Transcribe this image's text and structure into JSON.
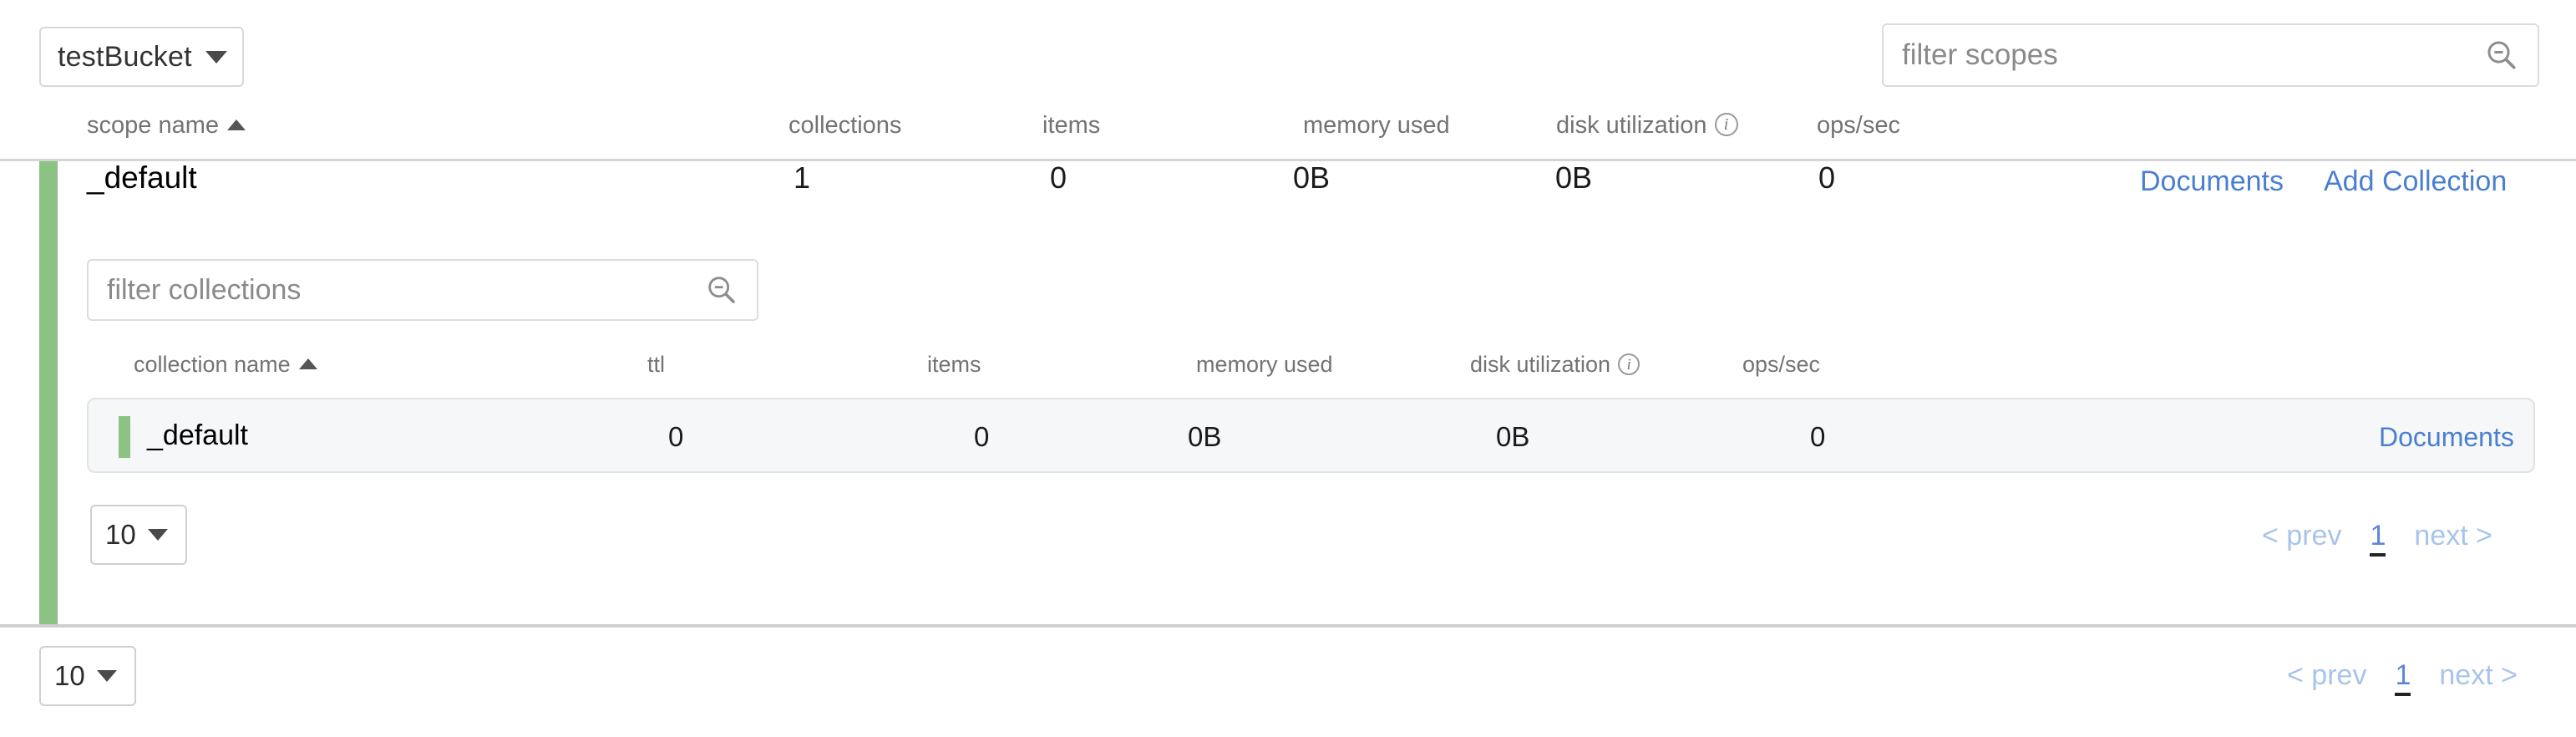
{
  "toolbar": {
    "bucket_selector": {
      "value": "testBucket",
      "icon": "chevron-down-icon"
    },
    "scope_filter": {
      "value": "",
      "placeholder": "filter scopes",
      "icon": "search-zoom-out-icon"
    }
  },
  "scopes_table": {
    "columns": [
      {
        "key": "scope_name",
        "label": "scope name",
        "sorted": "asc",
        "sort_icon": "caret-up-icon"
      },
      {
        "key": "collections",
        "label": "collections"
      },
      {
        "key": "items",
        "label": "items"
      },
      {
        "key": "memory_used",
        "label": "memory used"
      },
      {
        "key": "disk_utilization",
        "label": "disk utilization",
        "info_icon": "info-circle-icon"
      },
      {
        "key": "ops_sec",
        "label": "ops/sec"
      }
    ],
    "rows": [
      {
        "scope_name": "_default",
        "collections": "1",
        "items": "0",
        "memory_used": "0B",
        "disk_utilization": "0B",
        "ops_sec": "0",
        "actions": {
          "documents": "Documents",
          "add_collection": "Add Collection"
        }
      }
    ],
    "pagination": {
      "page_size": "10",
      "prev": "< prev",
      "current_page": "1",
      "next": "next >"
    }
  },
  "collections_panel": {
    "filter": {
      "value": "",
      "placeholder": "filter collections",
      "icon": "search-zoom-out-icon"
    },
    "columns": [
      {
        "key": "collection_name",
        "label": "collection name",
        "sorted": "asc",
        "sort_icon": "caret-up-icon"
      },
      {
        "key": "ttl",
        "label": "ttl"
      },
      {
        "key": "items",
        "label": "items"
      },
      {
        "key": "memory_used",
        "label": "memory used"
      },
      {
        "key": "disk_utilization",
        "label": "disk utilization",
        "info_icon": "info-circle-icon"
      },
      {
        "key": "ops_sec",
        "label": "ops/sec"
      }
    ],
    "rows": [
      {
        "collection_name": "_default",
        "ttl": "0",
        "items": "0",
        "memory_used": "0B",
        "disk_utilization": "0B",
        "ops_sec": "0",
        "actions": {
          "documents": "Documents"
        }
      }
    ],
    "pagination": {
      "page_size": "10",
      "prev": "< prev",
      "current_page": "1",
      "next": "next >"
    }
  },
  "colors": {
    "accent_green": "#8cc283",
    "link_blue": "#4a7fd0",
    "pager_blue": "#a8c4ea",
    "pager_active_blue": "#5b87d8",
    "row_background": "#f6f7f8",
    "border_gray": "#d5d5d5",
    "muted_text": "#737373"
  }
}
